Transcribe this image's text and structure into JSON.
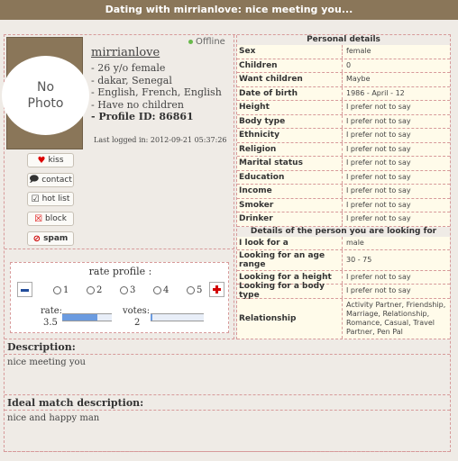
{
  "title": "Dating with mirrianlove: nice meeting you...",
  "profile": {
    "photo_text": "No Photo",
    "status": "Offline",
    "username": "mirrianlove",
    "info": [
      "- 26 y/o female",
      "- dakar, Senegal",
      "- English, French, English",
      "- Have no children"
    ],
    "profile_id_label": "- Profile ID:",
    "profile_id": "86861",
    "last_logged": "Last logged in: 2012-09-21 05:37:26"
  },
  "actions": {
    "kiss": "kiss",
    "contact": "contact",
    "hotlist": "hot list",
    "block": "block",
    "spam": "spam"
  },
  "rating": {
    "title": "rate profile :",
    "options": [
      "1",
      "2",
      "3",
      "4",
      "5"
    ],
    "rate_label": "rate:",
    "rate_value": "3.5",
    "votes_label": "votes:",
    "votes_value": "2",
    "rate_fraction": 0.7,
    "votes_fraction": 0.04
  },
  "personal": {
    "heading": "Personal details",
    "rows": [
      {
        "k": "Sex",
        "v": "female"
      },
      {
        "k": "Children",
        "v": "0"
      },
      {
        "k": "Want children",
        "v": "Maybe"
      },
      {
        "k": "Date of birth",
        "v": "1986 - April - 12"
      },
      {
        "k": "Height",
        "v": "I prefer not to say"
      },
      {
        "k": "Body type",
        "v": "I prefer not to say"
      },
      {
        "k": "Ethnicity",
        "v": "I prefer not to say"
      },
      {
        "k": "Religion",
        "v": "I prefer not to say"
      },
      {
        "k": "Marital status",
        "v": "I prefer not to say"
      },
      {
        "k": "Education",
        "v": "I prefer not to say"
      },
      {
        "k": "Income",
        "v": "I prefer not to say"
      },
      {
        "k": "Smoker",
        "v": "I prefer not to say"
      },
      {
        "k": "Drinker",
        "v": "I prefer not to say"
      }
    ]
  },
  "looking": {
    "heading": "Details of the person you are looking for",
    "rows": [
      {
        "k": "I look for a",
        "v": "male"
      },
      {
        "k": "Looking for an age range",
        "v": "30 -  75"
      },
      {
        "k": "Looking for a height",
        "v": "I prefer not to say"
      },
      {
        "k": "Looking for a body type",
        "v": "I prefer not to say"
      },
      {
        "k": "Relationship",
        "v": "Activity Partner, Friendship, Marriage, Relationship, Romance, Casual, Travel Partner, Pen Pal"
      }
    ]
  },
  "description": {
    "heading": "Description:",
    "text": "nice meeting you"
  },
  "ideal": {
    "heading": "Ideal match description:",
    "text": "nice and happy man"
  }
}
